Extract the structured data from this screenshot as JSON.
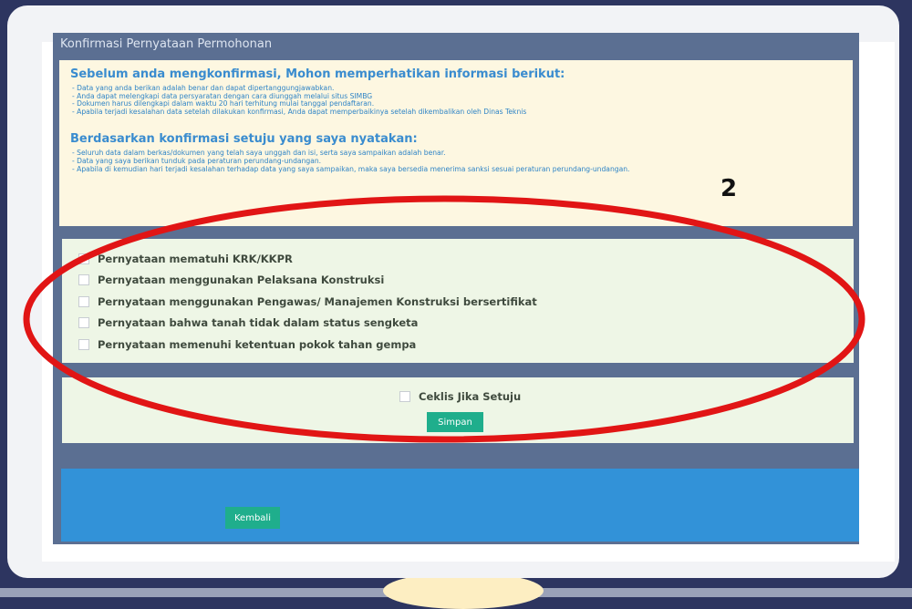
{
  "panel": {
    "title": "Konfirmasi Pernyataan Permohonan"
  },
  "notice": {
    "heading": "Sebelum anda mengkonfirmasi, Mohon memperhatikan informasi berikut:",
    "items": [
      "- Data yang anda berikan adalah benar dan dapat dipertanggungjawabkan.",
      "- Anda dapat melengkapi data persyaratan dengan cara diunggah melalui situs SIMBG",
      "- Dokumen harus dilengkapi dalam waktu 20 hari terhitung mulai tanggal pendaftaran.",
      "- Apabila terjadi kesalahan data setelah dilakukan konfirmasi, Anda dapat memperbaikinya setelah dikembalikan oleh Dinas Teknis"
    ]
  },
  "agreement": {
    "heading": "Berdasarkan konfirmasi setuju yang saya nyatakan:",
    "items": [
      "- Seluruh data dalam berkas/dokumen yang telah saya unggah dan isi, serta saya sampaikan adalah benar.",
      "- Data yang saya berikan tunduk pada peraturan perundang-undangan.",
      "- Apabila di kemudian hari terjadi kesalahan terhadap data yang saya sampaikan, maka saya bersedia menerima sanksi sesuai peraturan perundang-undangan."
    ]
  },
  "statements": [
    {
      "label": "Pernyataan mematuhi KRK/KKPR",
      "checked": false
    },
    {
      "label": "Pernyataan menggunakan Pelaksana Konstruksi",
      "checked": false
    },
    {
      "label": "Pernyataan menggunakan Pengawas/ Manajemen Konstruksi bersertifikat",
      "checked": false
    },
    {
      "label": "Pernyataan bahwa tanah tidak dalam status sengketa",
      "checked": false
    },
    {
      "label": "Pernyataan memenuhi ketentuan pokok tahan gempa",
      "checked": false
    }
  ],
  "consent": {
    "label": "Ceklis Jika Setuju",
    "checked": false
  },
  "buttons": {
    "save": "Simpan",
    "back": "Kembali"
  },
  "annotation": {
    "number": "2",
    "color": "#e11515"
  },
  "colors": {
    "accent_green": "#1fae8c",
    "header_slate": "#5b6f92",
    "footer_blue": "#3292d8"
  }
}
